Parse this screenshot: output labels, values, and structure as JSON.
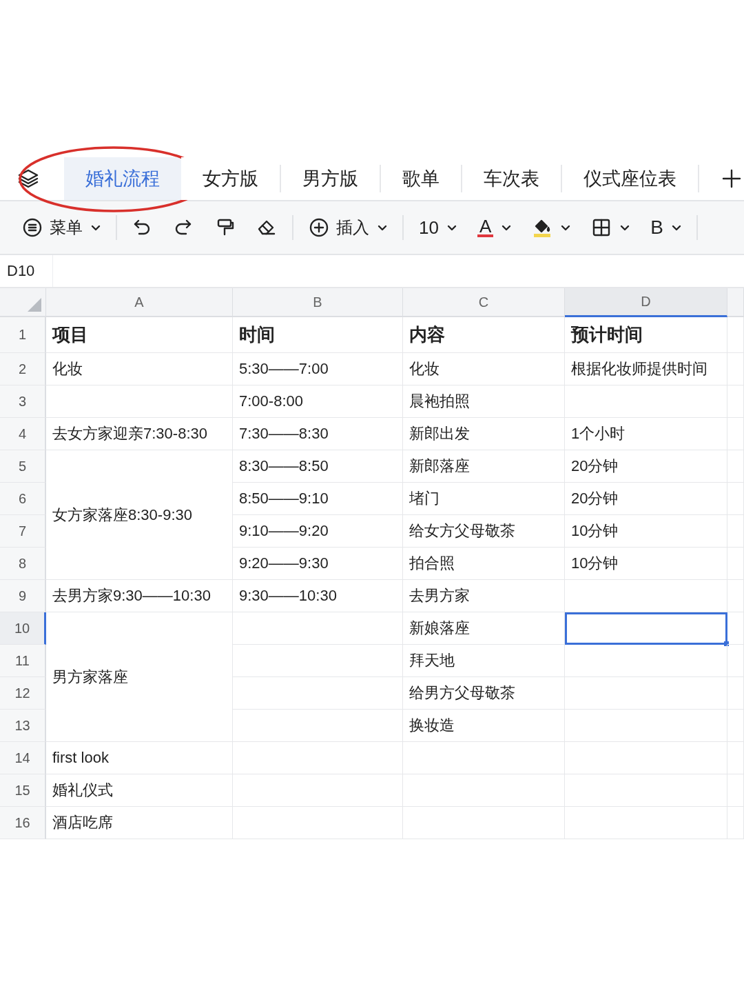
{
  "sheet_tabs": [
    {
      "label": "婚礼流程",
      "selected": true,
      "circled": true
    },
    {
      "label": "女方版",
      "selected": false,
      "circled": false
    },
    {
      "label": "男方版",
      "selected": false,
      "circled": false
    },
    {
      "label": "歌单",
      "selected": false,
      "circled": false
    },
    {
      "label": "车次表",
      "selected": false,
      "circled": false
    },
    {
      "label": "仪式座位表",
      "selected": false,
      "circled": false
    }
  ],
  "toolbar": [
    {
      "kind": "menu",
      "label": "菜单",
      "dropdown": true
    },
    {
      "kind": "divider"
    },
    {
      "kind": "undo"
    },
    {
      "kind": "redo"
    },
    {
      "kind": "painter"
    },
    {
      "kind": "eraser"
    },
    {
      "kind": "divider"
    },
    {
      "kind": "insert",
      "label": "插入",
      "dropdown": true
    },
    {
      "kind": "divider"
    },
    {
      "kind": "fontsize",
      "label": "10",
      "dropdown": true
    },
    {
      "kind": "textcolor",
      "label": "A",
      "color": "#e0383e",
      "dropdown": true
    },
    {
      "kind": "fillcolor",
      "color": "#f3d54e",
      "dropdown": true
    },
    {
      "kind": "borders",
      "dropdown": true
    },
    {
      "kind": "bold",
      "label": "B",
      "dropdown": true
    },
    {
      "kind": "divider"
    }
  ],
  "name_box": "D10",
  "columns": [
    {
      "label": "A",
      "selected": false
    },
    {
      "label": "B",
      "selected": false
    },
    {
      "label": "C",
      "selected": false
    },
    {
      "label": "D",
      "selected": true
    }
  ],
  "rows": [
    {
      "header": "1",
      "kind": "heading",
      "selected": false,
      "cells": {
        "A": {
          "text": "项目"
        },
        "B": {
          "text": "时间"
        },
        "C": {
          "text": "内容"
        },
        "D": {
          "text": "预计时间"
        }
      }
    },
    {
      "header": "2",
      "kind": "data",
      "selected": false,
      "cells": {
        "A": {
          "text": "化妆"
        },
        "B": {
          "text": "5:30——7:00"
        },
        "C": {
          "text": "化妆"
        },
        "D": {
          "text": "根据化妆师提供时间"
        }
      }
    },
    {
      "header": "3",
      "kind": "data",
      "selected": false,
      "cells": {
        "B": {
          "text": "7:00-8:00"
        },
        "C": {
          "text": "晨袍拍照"
        }
      }
    },
    {
      "header": "4",
      "kind": "data",
      "selected": false,
      "cells": {
        "A": {
          "text": "去女方家迎亲7:30-8:30"
        },
        "B": {
          "text": "7:30——8:30"
        },
        "C": {
          "text": "新郎出发"
        },
        "D": {
          "text": "1个小时"
        }
      }
    },
    {
      "header": "5",
      "kind": "data",
      "selected": false,
      "cells": {
        "A": {
          "text": "女方家落座8:30-9:30"
        },
        "B": {
          "text": "8:30——8:50"
        },
        "C": {
          "text": "新郎落座"
        },
        "D": {
          "text": "20分钟"
        }
      }
    },
    {
      "header": "6",
      "kind": "data",
      "selected": false,
      "cells": {
        "A": {
          "merged": true
        },
        "B": {
          "text": "8:50——9:10"
        },
        "C": {
          "text": "堵门"
        },
        "D": {
          "text": "20分钟"
        }
      }
    },
    {
      "header": "7",
      "kind": "data",
      "selected": false,
      "cells": {
        "A": {
          "merged": true
        },
        "B": {
          "text": "9:10——9:20"
        },
        "C": {
          "text": "给女方父母敬茶"
        },
        "D": {
          "text": "10分钟"
        }
      }
    },
    {
      "header": "8",
      "kind": "data",
      "selected": false,
      "cells": {
        "A": {
          "merged": true
        },
        "B": {
          "text": "9:20——9:30"
        },
        "C": {
          "text": "拍合照"
        },
        "D": {
          "text": "10分钟"
        }
      }
    },
    {
      "header": "9",
      "kind": "data",
      "selected": false,
      "cells": {
        "A": {
          "text": "去男方家9:30——10:30"
        },
        "B": {
          "text": "9:30——10:30"
        },
        "C": {
          "text": "去男方家"
        }
      }
    },
    {
      "header": "10",
      "kind": "data",
      "selected": true,
      "cells": {
        "A": {
          "text": "男方家落座"
        },
        "C": {
          "text": "新娘落座"
        }
      }
    },
    {
      "header": "11",
      "kind": "data",
      "selected": false,
      "cells": {
        "A": {
          "merged": true
        },
        "C": {
          "text": "拜天地"
        }
      }
    },
    {
      "header": "12",
      "kind": "data",
      "selected": false,
      "cells": {
        "A": {
          "merged": true
        },
        "C": {
          "text": "给男方父母敬茶"
        }
      }
    },
    {
      "header": "13",
      "kind": "data",
      "selected": false,
      "cells": {
        "A": {
          "merged": true
        },
        "C": {
          "text": "换妆造"
        }
      }
    },
    {
      "header": "14",
      "kind": "data",
      "selected": false,
      "cells": {
        "A": {
          "text": "first look"
        }
      }
    },
    {
      "header": "15",
      "kind": "data",
      "selected": false,
      "cells": {
        "A": {
          "text": "婚礼仪式"
        }
      }
    },
    {
      "header": "16",
      "kind": "data",
      "selected": false,
      "cells": {
        "A": {
          "text": "酒店吃席"
        }
      }
    }
  ]
}
